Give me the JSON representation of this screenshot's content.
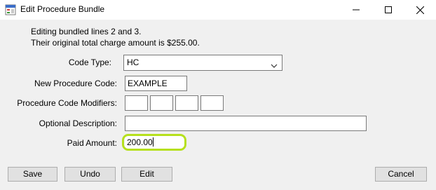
{
  "window": {
    "title": "Edit Procedure Bundle",
    "controls": {
      "minimize": "minimize",
      "maximize": "maximize",
      "close": "close"
    }
  },
  "info": {
    "line1": "Editing bundled lines 2 and 3.",
    "line2": "Their original total charge amount is $255.00."
  },
  "form": {
    "code_type_label": "Code Type:",
    "code_type_value": "HC",
    "new_code_label": "New Procedure Code:",
    "new_code_value": "EXAMPLE",
    "modifiers_label": "Procedure Code Modifiers:",
    "modifiers": [
      "",
      "",
      "",
      ""
    ],
    "description_label": "Optional Description:",
    "description_value": "",
    "paid_label": "Paid Amount:",
    "paid_value": "200.00"
  },
  "buttons": {
    "save": "Save",
    "undo": "Undo",
    "edit": "Edit",
    "cancel": "Cancel"
  },
  "colors": {
    "highlight": "#b6e01d",
    "titlebar": "#ffffff",
    "client": "#f0f0f0"
  },
  "icons": {
    "app": "app-form-icon",
    "dropdown": "chevron-down-icon"
  }
}
